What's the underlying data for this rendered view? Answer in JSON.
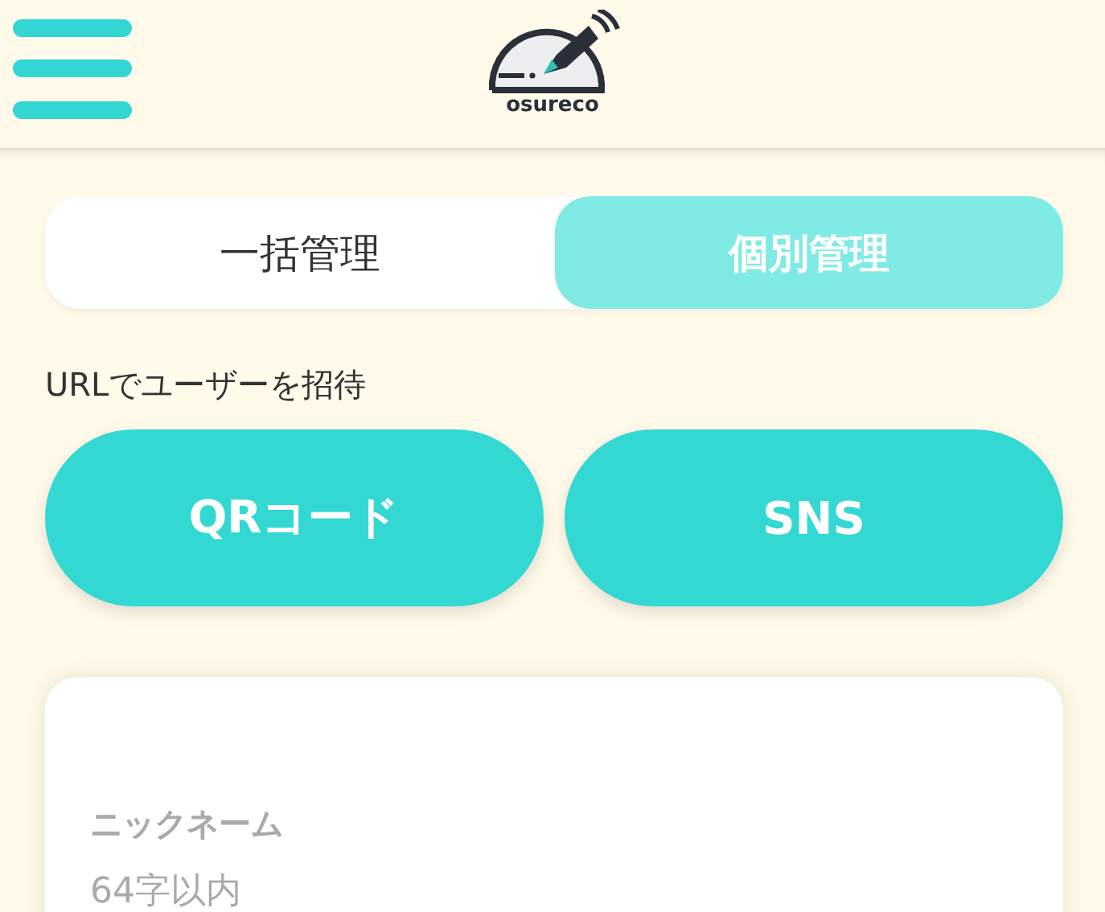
{
  "header": {
    "logo_text": "osureco"
  },
  "tabs": [
    {
      "label": "一括管理",
      "selected": false
    },
    {
      "label": "個別管理",
      "selected": true
    }
  ],
  "invite_label": "URLでユーザーを招待",
  "invite_buttons": [
    "QRコード",
    "SNS"
  ],
  "form": {
    "field_label": "ニックネーム",
    "placeholder": "64字以内"
  }
}
